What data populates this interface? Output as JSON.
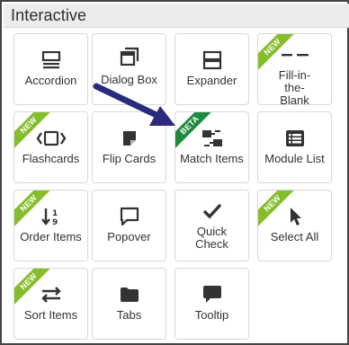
{
  "header": {
    "title": "Interactive"
  },
  "badges": {
    "new": "NEW",
    "beta": "BETA"
  },
  "tiles": [
    {
      "label": "Accordion",
      "icon": "accordion-icon"
    },
    {
      "label": "Dialog Box",
      "icon": "dialog-box-icon"
    },
    {
      "label": "Expander",
      "icon": "expander-icon"
    },
    {
      "label": "Fill-in-the-Blank",
      "icon": "fill-in-blank-icon",
      "badge": "NEW"
    },
    {
      "label": "Flashcards",
      "icon": "flashcards-icon",
      "badge": "NEW"
    },
    {
      "label": "Flip Cards",
      "icon": "flip-cards-icon"
    },
    {
      "label": "Match Items",
      "icon": "match-items-icon",
      "badge": "BETA"
    },
    {
      "label": "Module List",
      "icon": "module-list-icon"
    },
    {
      "label": "Order Items",
      "icon": "order-items-icon",
      "badge": "NEW"
    },
    {
      "label": "Popover",
      "icon": "popover-icon"
    },
    {
      "label": "Quick Check",
      "icon": "checkmark-icon"
    },
    {
      "label": "Select All",
      "icon": "cursor-arrow-icon",
      "badge": "NEW"
    },
    {
      "label": "Sort Items",
      "icon": "sort-arrows-icon",
      "badge": "NEW"
    },
    {
      "label": "Tabs",
      "icon": "folder-tab-icon"
    },
    {
      "label": "Tooltip",
      "icon": "tooltip-icon"
    }
  ],
  "colors": {
    "new_badge": "#86bd2c",
    "beta_badge": "#1e8a3e",
    "arrow": "#2b2a7c",
    "icon": "#333333"
  }
}
